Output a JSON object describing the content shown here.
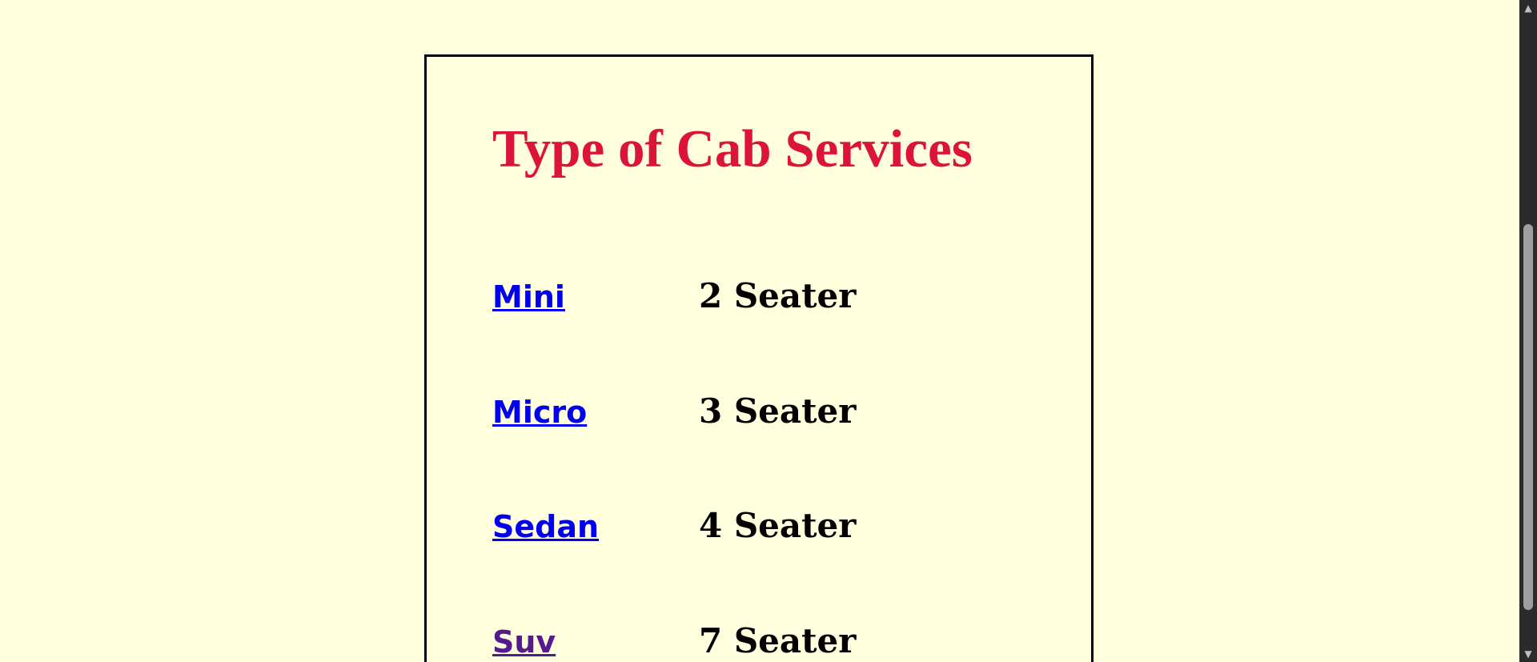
{
  "heading": "Type of Cab Services",
  "cabs": [
    {
      "name": "Mini",
      "seats": "2 Seater",
      "visited": false
    },
    {
      "name": "Micro",
      "seats": "3 Seater",
      "visited": false
    },
    {
      "name": "Sedan",
      "seats": "4 Seater",
      "visited": false
    },
    {
      "name": "Suv",
      "seats": "7 Seater",
      "visited": true
    }
  ],
  "colors": {
    "background": "#FFFEDD",
    "heading": "#DC143C",
    "link": "#0000EE",
    "link_visited": "#551A8B",
    "text": "#000000"
  },
  "scrollbar": {
    "up_icon": "arrow-up-icon",
    "down_icon": "arrow-down-icon"
  }
}
